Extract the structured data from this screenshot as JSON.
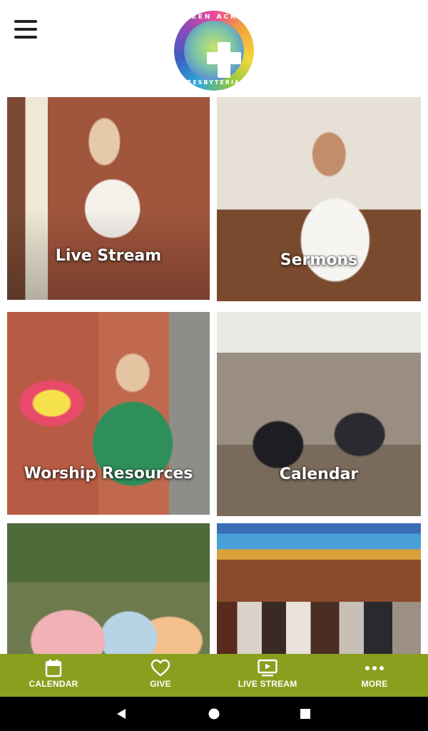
{
  "header": {
    "menu_icon": "hamburger-menu-icon",
    "logo": {
      "text_top": "GREEN ACRES",
      "text_bottom": "PRESBYTERIAN",
      "icon": "cross-tree-icon"
    }
  },
  "tiles": [
    {
      "label": "Live Stream"
    },
    {
      "label": "Sermons"
    },
    {
      "label": "Worship Resources"
    },
    {
      "label": "Calendar"
    },
    {
      "label": ""
    },
    {
      "label": ""
    }
  ],
  "bottom_nav": {
    "background": "#8b9f1f",
    "items": [
      {
        "label": "CALENDAR",
        "icon": "calendar-icon"
      },
      {
        "label": "GIVE",
        "icon": "heart-icon"
      },
      {
        "label": "LIVE STREAM",
        "icon": "play-screen-icon"
      },
      {
        "label": "MORE",
        "icon": "more-dots-icon"
      }
    ]
  },
  "system_bar": {
    "buttons": [
      "back-icon",
      "home-icon",
      "recents-icon"
    ]
  }
}
